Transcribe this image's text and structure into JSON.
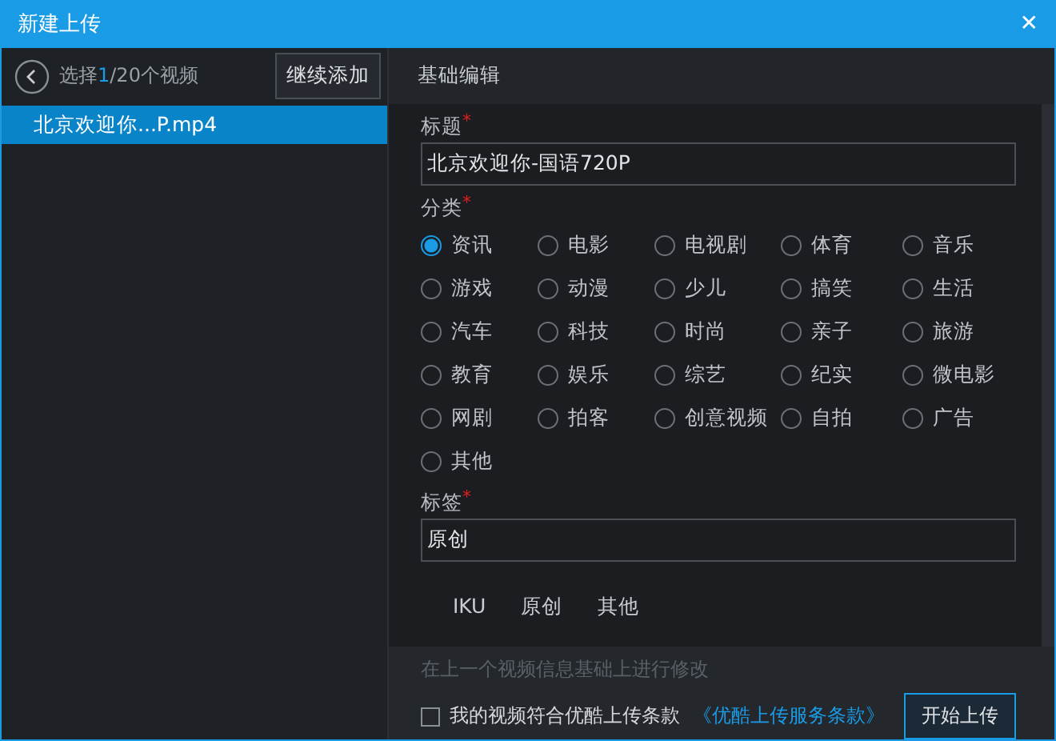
{
  "window": {
    "title": "新建上传",
    "close": "✕"
  },
  "sidebar": {
    "counter_before": "选择",
    "counter_current": "1",
    "counter_after": "/20个视频",
    "add_button": "继续添加",
    "items": [
      {
        "label": "北京欢迎你...P.mp4",
        "selected": true
      }
    ]
  },
  "section_tab": "基础编辑",
  "form": {
    "title_label": {
      "text": "标题",
      "required_mark": "*"
    },
    "title_value": "北京欢迎你-国语720P",
    "category_label": {
      "text": "分类",
      "required_mark": "*"
    },
    "categories": [
      {
        "label": "资讯",
        "selected": true
      },
      {
        "label": "电影",
        "selected": false
      },
      {
        "label": "电视剧",
        "selected": false
      },
      {
        "label": "体育",
        "selected": false
      },
      {
        "label": "音乐",
        "selected": false
      },
      {
        "label": "游戏",
        "selected": false
      },
      {
        "label": "动漫",
        "selected": false
      },
      {
        "label": "少儿",
        "selected": false
      },
      {
        "label": "搞笑",
        "selected": false
      },
      {
        "label": "生活",
        "selected": false
      },
      {
        "label": "汽车",
        "selected": false
      },
      {
        "label": "科技",
        "selected": false
      },
      {
        "label": "时尚",
        "selected": false
      },
      {
        "label": "亲子",
        "selected": false
      },
      {
        "label": "旅游",
        "selected": false
      },
      {
        "label": "教育",
        "selected": false
      },
      {
        "label": "娱乐",
        "selected": false
      },
      {
        "label": "综艺",
        "selected": false
      },
      {
        "label": "纪实",
        "selected": false
      },
      {
        "label": "微电影",
        "selected": false
      },
      {
        "label": "网剧",
        "selected": false
      },
      {
        "label": "拍客",
        "selected": false
      },
      {
        "label": "创意视频",
        "selected": false
      },
      {
        "label": "自拍",
        "selected": false
      },
      {
        "label": "广告",
        "selected": false
      },
      {
        "label": "其他",
        "selected": false
      }
    ],
    "tags_label": {
      "text": "标签",
      "required_mark": "*"
    },
    "tags_value": "原创",
    "tag_suggestions": [
      "IKU",
      "原创",
      "其他"
    ]
  },
  "footer": {
    "hint": "在上一个视频信息基础上进行修改",
    "agree": {
      "checked": false,
      "label": "我的视频符合优酷上传条款",
      "link": "《优酷上传服务条款》"
    },
    "upload_button": "开始上传"
  }
}
